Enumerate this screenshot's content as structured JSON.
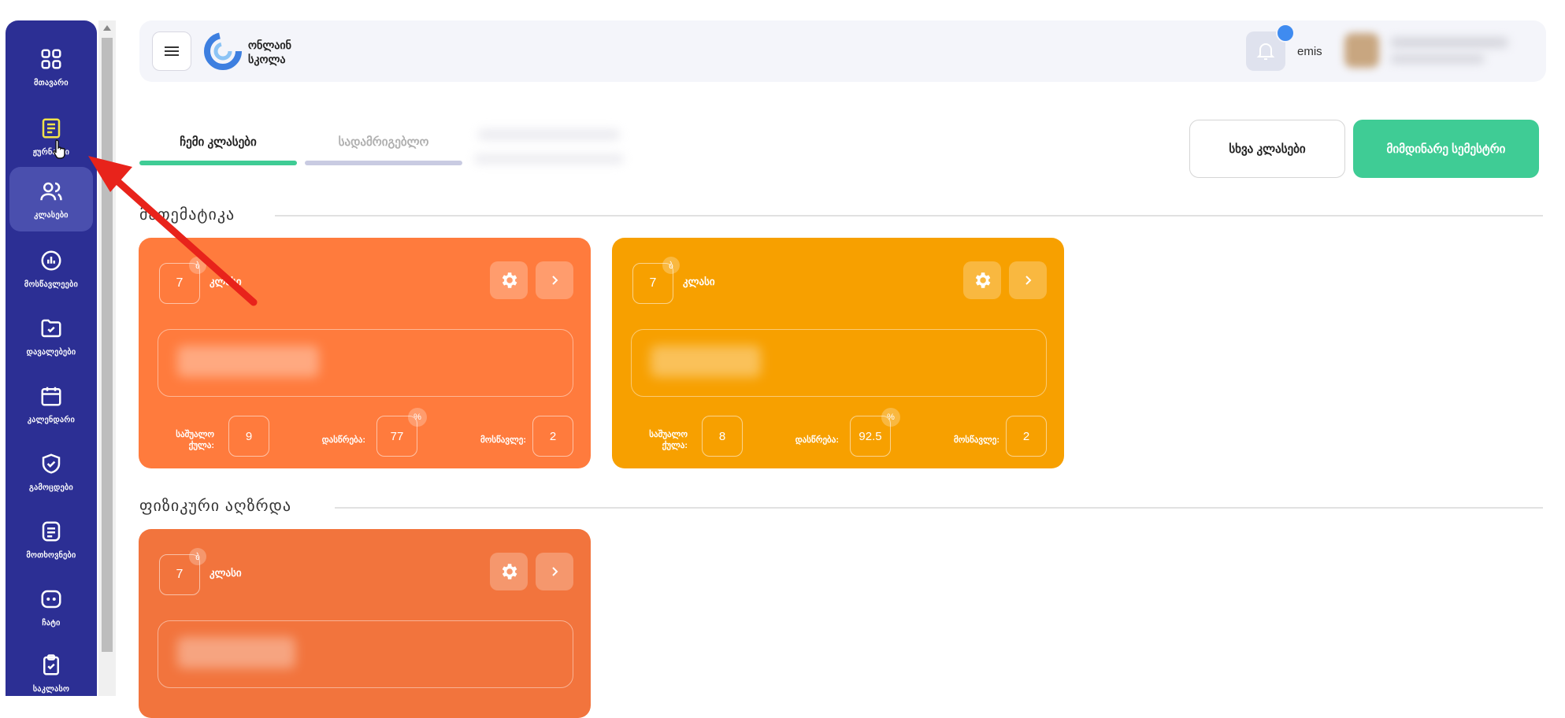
{
  "sidebar": {
    "items": [
      {
        "label": "მთავარი",
        "icon": "grid-icon"
      },
      {
        "label": "ჟურნალი",
        "icon": "journal-icon"
      },
      {
        "label": "კლასები",
        "icon": "users-icon"
      },
      {
        "label": "მოსწავლეები",
        "icon": "chart-icon"
      },
      {
        "label": "დავალებები",
        "icon": "folder-check-icon"
      },
      {
        "label": "კალენდარი",
        "icon": "calendar-icon"
      },
      {
        "label": "გამოცდები",
        "icon": "shield-check-icon"
      },
      {
        "label": "მოთხოვნები",
        "icon": "document-icon"
      },
      {
        "label": "ჩატი",
        "icon": "chat-icon"
      },
      {
        "label": "საკლასო",
        "icon": "clipboard-check-icon"
      }
    ],
    "active_index": 2
  },
  "header": {
    "logo_line1": "ონლაინ",
    "logo_line2": "სკოლა",
    "user_name": "emis"
  },
  "tabs": [
    {
      "label": "ჩემი კლასები",
      "active": true
    },
    {
      "label": "სადამრიგებლო",
      "active": false
    }
  ],
  "buttons": {
    "other_classes": "სხვა კლასები",
    "current_semester": "მიმდინარე სემესტრი"
  },
  "sections": [
    {
      "title": "მათემატიკა",
      "cards": [
        {
          "grade": "7",
          "grade_sup": "ბ",
          "class_label": "კლასი",
          "color": "#ff7b3d",
          "stats": {
            "hours_label": "საშუალო ქულა:",
            "hours": "9",
            "attendance_label": "დასწრება:",
            "attendance": "77",
            "attendance_unit": "%",
            "students_label": "მოსწავლე:",
            "students": "2"
          }
        },
        {
          "grade": "7",
          "grade_sup": "ბ",
          "class_label": "კლასი",
          "color": "#f7a000",
          "stats": {
            "hours_label": "საშუალო ქულა:",
            "hours": "8",
            "attendance_label": "დასწრება:",
            "attendance": "92.5",
            "attendance_unit": "%",
            "students_label": "მოსწავლე:",
            "students": "2"
          }
        }
      ]
    },
    {
      "title": "ფიზიკური აღზრდა",
      "cards": [
        {
          "grade": "7",
          "grade_sup": "ბ",
          "class_label": "კლასი",
          "color": "#f2743d"
        }
      ]
    }
  ],
  "colors": {
    "sidebar": "#2c2f94",
    "primary_button": "#3fcc95",
    "tab_active": "#3fcc95",
    "tab_inactive": "#c9cbe2"
  }
}
